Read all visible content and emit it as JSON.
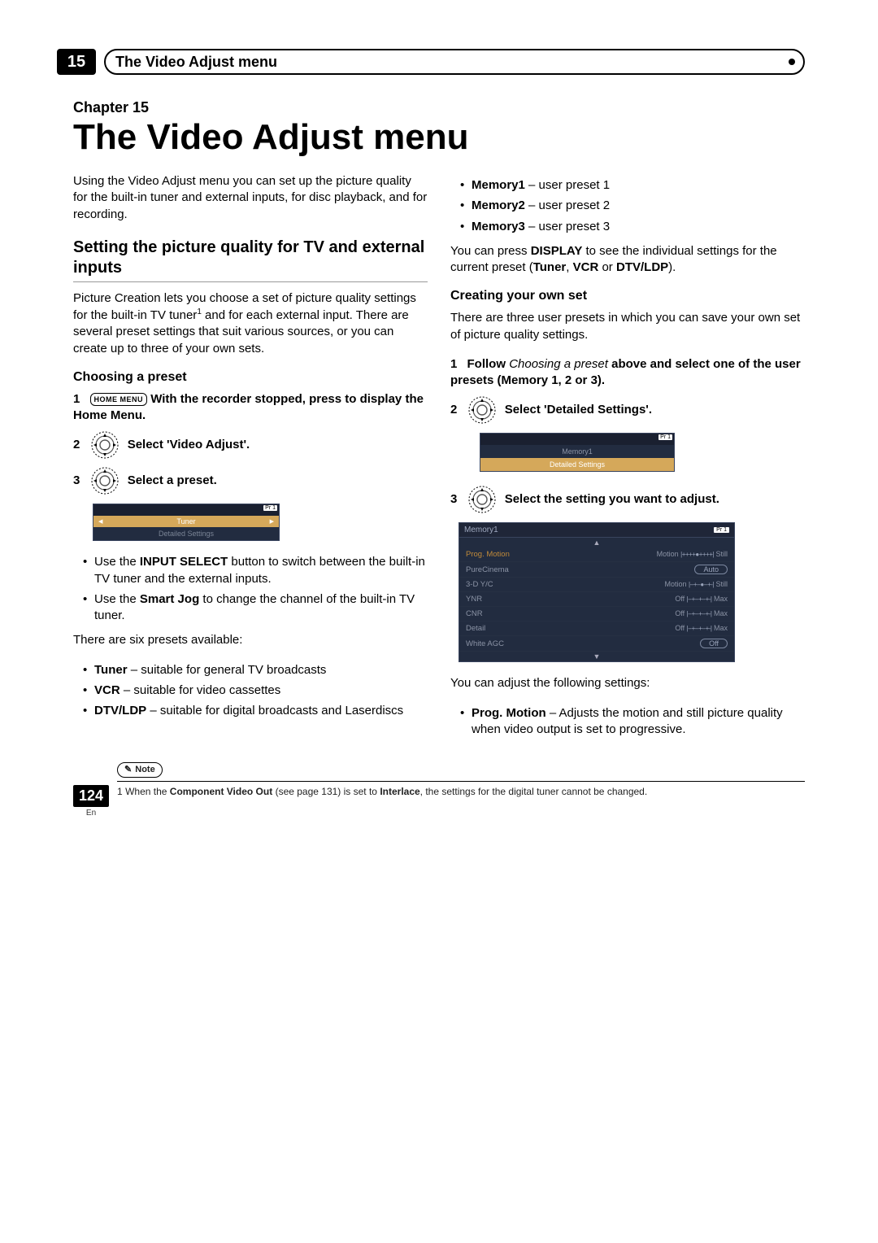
{
  "chapter_bar_number": "15",
  "chapter_bar_title": "The Video Adjust menu",
  "chapter_label": "Chapter 15",
  "main_title": "The Video Adjust menu",
  "intro_para": "Using the Video Adjust menu you can set up the picture quality for the built-in tuner and external inputs, for disc playback, and for recording.",
  "section_pq_title": "Setting the picture quality for TV and external inputs",
  "pq_para_a": "Picture Creation lets you choose a set of picture quality settings for the built-in TV tuner",
  "pq_footnote_mark": "1",
  "pq_para_b": " and for each external input. There are several preset settings that suit various sources, or you can create up to three of your own sets.",
  "sub_choosing": "Choosing a preset",
  "step1_num": "1",
  "home_menu_badge": "HOME MENU",
  "step1_text": " With the recorder stopped, press to display the Home Menu.",
  "step2_num": "2",
  "step2_text": "Select 'Video Adjust'.",
  "step3_num": "3",
  "step3_text": "Select a preset.",
  "ui1_badge": "Pr 1",
  "ui1_selected": "Tuner",
  "ui1_dim": "Detailed Settings",
  "bullet_input_a": "Use the ",
  "bullet_input_b": "INPUT SELECT",
  "bullet_input_c": " button to switch between the built-in TV tuner and the external inputs.",
  "bullet_smart_a": "Use the ",
  "bullet_smart_b": "Smart Jog",
  "bullet_smart_c": " to change the channel of the built-in TV tuner.",
  "presets_intro": "There are six presets available:",
  "preset_tuner_b": "Tuner",
  "preset_tuner_t": " – suitable for general TV broadcasts",
  "preset_vcr_b": "VCR",
  "preset_vcr_t": " – suitable for video cassettes",
  "preset_dtv_b": "DTV/LDP",
  "preset_dtv_t": " – suitable for digital broadcasts and Laserdiscs",
  "preset_m1_b": "Memory1",
  "preset_m1_t": " – user preset 1",
  "preset_m2_b": "Memory2",
  "preset_m2_t": " – user preset 2",
  "preset_m3_b": "Memory3",
  "preset_m3_t": " – user preset 3",
  "display_a": "You can press ",
  "display_b": "DISPLAY",
  "display_c": " to see the individual settings for the current preset (",
  "display_d": "Tuner",
  "display_e": ", ",
  "display_f": "VCR",
  "display_g": " or ",
  "display_h": "DTV/LDP",
  "display_i": ").",
  "sub_creating": "Creating your own set",
  "creating_para": "There are three user presets in which you can save your own set of picture quality settings.",
  "cstep1_num": "1",
  "cstep1_a": "Follow ",
  "cstep1_b": "Choosing a preset",
  "cstep1_c": " above and select one of the user presets (Memory 1, 2 or 3).",
  "cstep2_num": "2",
  "cstep2_text": "Select 'Detailed Settings'.",
  "ui2_badge": "Pr 1",
  "ui2_row1": "Memory1",
  "ui2_row2": "Detailed Settings",
  "cstep3_num": "3",
  "cstep3_text": "Select the setting you want to adjust.",
  "ui3_title": "Memory1",
  "ui3_badge": "Pr 1",
  "ui3_rows": [
    {
      "label": "Prog. Motion",
      "left": "Motion",
      "mid": "|++++●++++|",
      "right": "Still",
      "sel": true
    },
    {
      "label": "PureCinema",
      "pill": "Auto"
    },
    {
      "label": "3-D Y/C",
      "left": "Motion",
      "mid": "|--+--●--+-|",
      "right": "Still"
    },
    {
      "label": "YNR",
      "left": "Off",
      "mid": "|--+--+--+-|",
      "right": "Max"
    },
    {
      "label": "CNR",
      "left": "Off",
      "mid": "|--+--+--+-|",
      "right": "Max"
    },
    {
      "label": "Detail",
      "left": "Off",
      "mid": "|--+--+--+-|",
      "right": "Max"
    },
    {
      "label": "White AGC",
      "pill": "Off"
    }
  ],
  "adjust_intro": "You can adjust the following settings:",
  "adj_prog_b": "Prog. Motion",
  "adj_prog_t": " – Adjusts the motion and still picture quality when video output is set to progressive.",
  "note_label": "Note",
  "footnote_mark": "1",
  "footnote_a": "When the ",
  "footnote_b": "Component Video Out",
  "footnote_c": " (see page 131) is set to ",
  "footnote_d": "Interlace",
  "footnote_e": ", the settings for the digital tuner cannot be changed.",
  "page_number": "124",
  "page_lang": "En"
}
